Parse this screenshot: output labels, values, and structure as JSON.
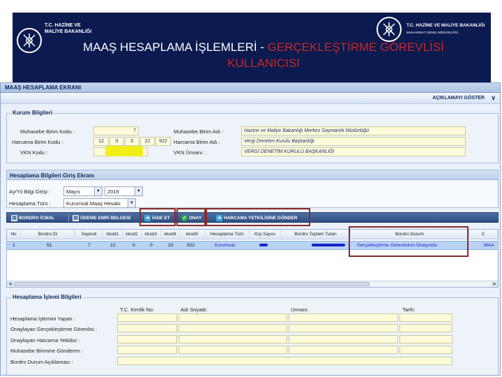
{
  "banner": {
    "left_logo_line1": "T.C. HAZİNE VE",
    "left_logo_line2": "MALİYE BAKANLIĞI",
    "right_logo_line1": "T.C. HAZİNE VE MALİYE BAKANLIĞI",
    "right_logo_line2": "MUHASEBAT GENEL MÜDÜRLÜĞÜ",
    "title_prefix": "MAAŞ HESAPLAMA İŞLEMLERİ - ",
    "title_highlight_line1": "GERÇEKLEŞTİRME GÖREVLİSİ",
    "title_highlight_line2": "KULLANICISI"
  },
  "app": {
    "window_title": "MAAŞ HESAPLAMA EKRANI",
    "info_toggle": "AÇIKLAMAYI GÖSTER"
  },
  "kurum": {
    "legend": "Kurum Bilgileri",
    "muhasebe_kodu_label": "Muhasebe Birim Kodu :",
    "muhasebe_kodu_value": "7",
    "harcama_kodu_label": "Harcama Birim Kodu :",
    "harcama_kodu_parts": [
      "12",
      "0",
      "0",
      "22",
      "922"
    ],
    "vkn_label": "VKN Kodu :",
    "vkn_value": "",
    "muhasebe_adi_label": "Muhasebe Birim Adı :",
    "muhasebe_adi_value": "Hazine ve Maliye Bakanlığı Merkez Saymanlık Müdürlüğü",
    "harcama_adi_label": "Harcama Birim Adı :",
    "harcama_adi_value": "Vergi Denetim Kurulu Başkanlığı",
    "vkn_unvan_label": "VKN Ünvanı :",
    "vkn_unvan_value": "VERGİ DENETİM KURULU BAŞKANLIĞI"
  },
  "hesaplama": {
    "panel_title": "Hesaplama Bilgileri Giriş Ekranı",
    "donem_label": "Ay/Yıl Bilgi Girişi :",
    "ay_value": "Mayıs",
    "yil_value": "2019",
    "tur_label": "Hesaplama Türü :",
    "tur_value": "Kurumsal Maaş Hesabı"
  },
  "toolbar": {
    "bordro_icmal": "BORDRO İCMAL",
    "odeme_emri": "ÖDEME EMRİ BELGESİ",
    "iade_et": "İADE ET",
    "onay": "ONAY",
    "harcama_yetkilisi": "HARCAMA YETKİLİSİNE GÖNDER"
  },
  "grid": {
    "columns": [
      "No",
      "Bordro ID",
      "Saykod",
      "kkod1",
      "kkod2",
      "kkod3",
      "kkod4",
      "kkod5",
      "Hesaplama Türü",
      "Kişi Sayısı",
      "Bordro Toplam Tutarı",
      "Bordro Durum",
      "C"
    ],
    "row": [
      "1",
      "51",
      "7",
      "12",
      "0",
      "0",
      "22",
      "922",
      "Kurumsal",
      "",
      "",
      "Gerçekleştirme Görevlisinin Onayında.",
      "MAA"
    ]
  },
  "islem": {
    "panel_title": "Hesaplama İşlemi Bilgileri",
    "col_tc": "T.C. Kimlik No:",
    "col_ad": "Adı Soyadı:",
    "col_unvan": "Unvanı:",
    "col_tarih": "Tarih:",
    "row1": "Hesaplama İşlemini Yapan :",
    "row2": "Onaylayan Gerçekleştirme Görevlisi :",
    "row3": "Onaylayan Harcama Yetkilisi :",
    "row4": "Muhasebe Birimine Gönderen :",
    "row5": "Bordro Durum Açıklaması :"
  },
  "colors": {
    "banner_bg": "#0b1a4f",
    "title_accent": "#c62828",
    "annotation_box": "#8b2a2a",
    "field_bg": "#fffbd8",
    "toolbar_bg": "#2f4f84",
    "selected_row": "#b9d3f5",
    "redaction_yellow": "#f2ee19",
    "redaction_blue": "#1722c9"
  },
  "icons": {
    "ministry_logo": "ministry-emblem-icon",
    "iade_icon": "arrow-right-icon",
    "onay_icon": "check-icon",
    "gonder_icon": "arrow-right-icon",
    "collapse": "chevron-double-down-icon"
  }
}
